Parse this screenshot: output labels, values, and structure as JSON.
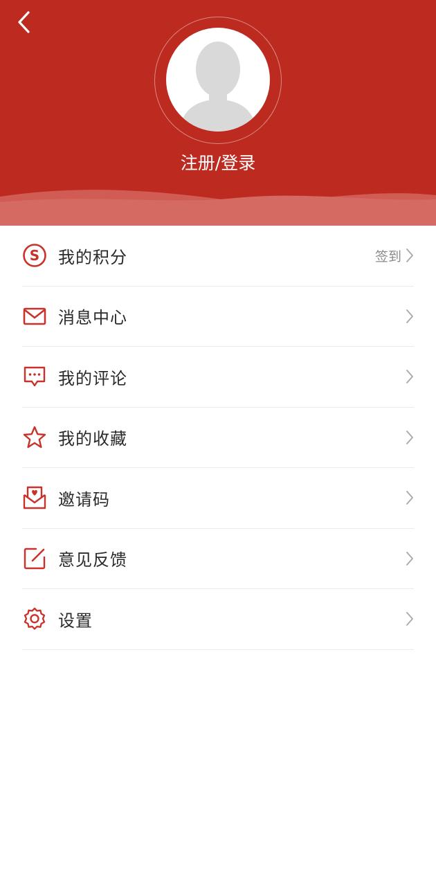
{
  "header": {
    "login_label": "注册/登录",
    "background_color": "#bc2a20",
    "back_icon": "chevron-left-icon",
    "avatar_icon": "default-avatar-icon"
  },
  "menu": {
    "accent_color": "#c8322a",
    "items": [
      {
        "label": "我的积分",
        "icon": "points-coin-icon",
        "extra": "签到"
      },
      {
        "label": "消息中心",
        "icon": "envelope-icon",
        "extra": ""
      },
      {
        "label": "我的评论",
        "icon": "comment-bubble-icon",
        "extra": ""
      },
      {
        "label": "我的收藏",
        "icon": "star-icon",
        "extra": ""
      },
      {
        "label": "邀请码",
        "icon": "invite-letter-icon",
        "extra": ""
      },
      {
        "label": "意见反馈",
        "icon": "edit-feedback-icon",
        "extra": ""
      },
      {
        "label": "设置",
        "icon": "gear-icon",
        "extra": ""
      }
    ]
  }
}
